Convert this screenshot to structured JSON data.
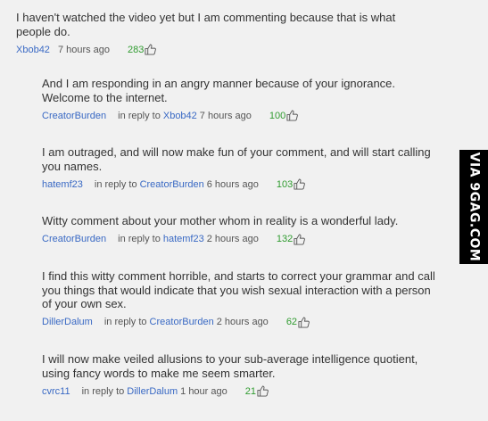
{
  "comments": [
    {
      "text": "I haven't watched the video yet but I am commenting because that is what people do.",
      "author": "Xbob42",
      "reply_prefix": "",
      "reply_to": "",
      "time": "7 hours ago",
      "likes": "283"
    },
    {
      "text": "And I am responding in an angry manner because of your ignorance. Welcome to the internet.",
      "author": "CreatorBurden",
      "reply_prefix": "in reply to",
      "reply_to": "Xbob42",
      "time": "7 hours ago",
      "likes": "100"
    },
    {
      "text": "I am outraged, and will now make fun of your comment, and will start calling you names.",
      "author": "hatemf23",
      "reply_prefix": "in reply to",
      "reply_to": "CreatorBurden",
      "time": "6 hours ago",
      "likes": "103"
    },
    {
      "text": "Witty comment about your mother whom in reality is a wonderful lady.",
      "author": "CreatorBurden",
      "reply_prefix": "in reply to",
      "reply_to": "hatemf23",
      "time": "2 hours ago",
      "likes": "132"
    },
    {
      "text": "I find this witty comment horrible, and starts to correct your grammar and call you things that would indicate that you wish sexual interaction with a person of your own sex.",
      "author": "DillerDalum",
      "reply_prefix": "in reply to",
      "reply_to": "CreatorBurden",
      "time": "2 hours ago",
      "likes": "62"
    },
    {
      "text": "I will now make veiled allusions to your sub-average intelligence quotient, using fancy words to make me seem smarter.",
      "author": "cvrc11",
      "reply_prefix": "in reply to",
      "reply_to": "DillerDalum",
      "time": "1 hour ago",
      "likes": "21"
    }
  ],
  "watermark": "VIA 9GAG.COM",
  "icons": {
    "like": "thumbs-up-icon"
  },
  "colors": {
    "link": "#3969c4",
    "likes": "#2f9b2f",
    "text": "#333333",
    "background": "#f1f1f1"
  }
}
